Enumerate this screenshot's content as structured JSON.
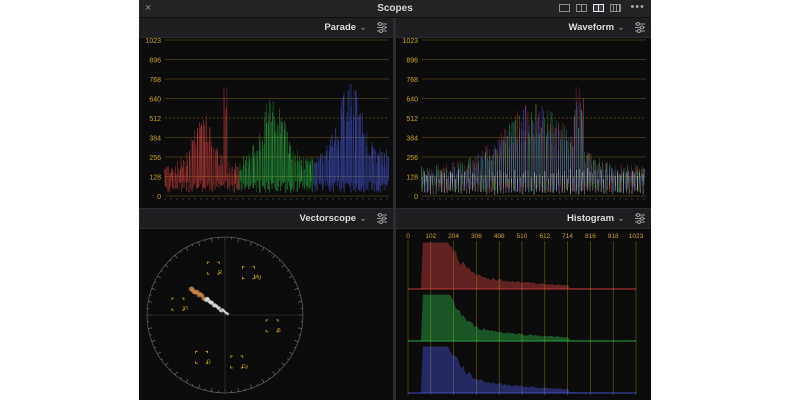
{
  "window": {
    "title": "Scopes",
    "close_icon": "×",
    "more_icon": "•••",
    "layout_options": [
      "single-layout-icon",
      "dual-layout-icon",
      "quad-layout-icon",
      "grid-layout-icon"
    ]
  },
  "panels": {
    "parade": {
      "title": "Parade",
      "chevron": "⌄"
    },
    "waveform": {
      "title": "Waveform",
      "chevron": "⌄"
    },
    "vectorscope": {
      "title": "Vectorscope",
      "chevron": "⌄"
    },
    "histogram": {
      "title": "Histogram",
      "chevron": "⌄"
    }
  },
  "waveform_scale": [
    "0",
    "128",
    "256",
    "384",
    "512",
    "640",
    "768",
    "896",
    "1023"
  ],
  "histogram_scale": [
    "0",
    "102",
    "204",
    "306",
    "408",
    "510",
    "612",
    "714",
    "816",
    "918",
    "1023"
  ],
  "vectorscope_targets": [
    {
      "label": "R",
      "angle": 104
    },
    {
      "label": "Mg",
      "angle": 61
    },
    {
      "label": "B",
      "angle": -13
    },
    {
      "label": "Cy",
      "angle": -76
    },
    {
      "label": "G",
      "angle": -119
    },
    {
      "label": "Yl",
      "angle": 167
    }
  ],
  "colors": {
    "accent": "#c9a227",
    "red": "#ff4d4d",
    "green": "#33dd55",
    "blue": "#5566ff",
    "panel_bg": "#0c0c0d"
  }
}
